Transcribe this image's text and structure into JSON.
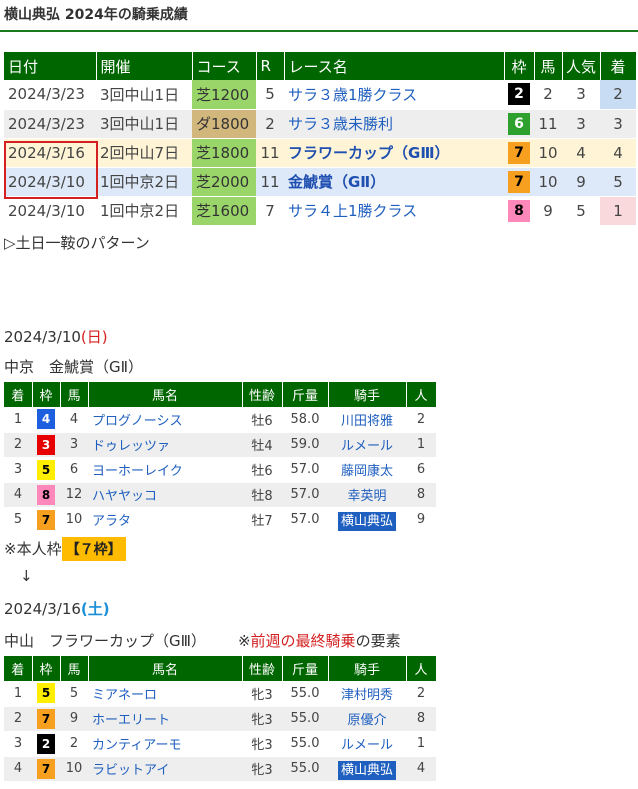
{
  "title": "横山典弘 2024年の騎乗成績",
  "results": {
    "headers": [
      "日付",
      "開催",
      "コース",
      "R",
      "レース名",
      "枠",
      "馬",
      "人気",
      "着"
    ],
    "rows": [
      {
        "date": "2024/3/23",
        "meet": "3回中山1日",
        "course": "芝1200",
        "r": "5",
        "race": "サラ３歳1勝クラス",
        "waku": "2",
        "uma": "2",
        "pop": "3",
        "rank": "2"
      },
      {
        "date": "2024/3/23",
        "meet": "3回中山1日",
        "course": "ダ1800",
        "r": "2",
        "race": "サラ３歳未勝利",
        "waku": "6",
        "uma": "11",
        "pop": "3",
        "rank": "3"
      },
      {
        "date": "2024/3/16",
        "meet": "2回中山7日",
        "course": "芝1800",
        "r": "11",
        "race": "フラワーカップ（GⅢ）",
        "waku": "7",
        "uma": "10",
        "pop": "4",
        "rank": "4"
      },
      {
        "date": "2024/3/10",
        "meet": "1回中京2日",
        "course": "芝2000",
        "r": "11",
        "race": "金鯱賞（GⅡ）",
        "waku": "7",
        "uma": "10",
        "pop": "9",
        "rank": "5"
      },
      {
        "date": "2024/3/10",
        "meet": "1回中京2日",
        "course": "芝1600",
        "r": "7",
        "race": "サラ４上1勝クラス",
        "waku": "8",
        "uma": "9",
        "pop": "5",
        "rank": "1"
      }
    ]
  },
  "pattern_note": "▷土日一鞍のパターン",
  "race1": {
    "date": "2024/3/10",
    "weekday": "(日)",
    "venue_title": "中京　金鯱賞（GⅡ）",
    "headers": [
      "着",
      "枠",
      "馬",
      "馬名",
      "性齢",
      "斤量",
      "騎手",
      "人"
    ],
    "rows": [
      {
        "rank": "1",
        "waku": "4",
        "uma": "4",
        "name": "プログノーシス",
        "sex": "牡6",
        "kin": "58.0",
        "jockey": "川田将雅",
        "pop": "2"
      },
      {
        "rank": "2",
        "waku": "3",
        "uma": "3",
        "name": "ドゥレッツァ",
        "sex": "牡4",
        "kin": "59.0",
        "jockey": "ルメール",
        "pop": "1"
      },
      {
        "rank": "3",
        "waku": "5",
        "uma": "6",
        "name": "ヨーホーレイク",
        "sex": "牡6",
        "kin": "57.0",
        "jockey": "藤岡康太",
        "pop": "6"
      },
      {
        "rank": "4",
        "waku": "8",
        "uma": "12",
        "name": "ハヤヤッコ",
        "sex": "牡8",
        "kin": "57.0",
        "jockey": "幸英明",
        "pop": "8"
      },
      {
        "rank": "5",
        "waku": "7",
        "uma": "10",
        "name": "アラタ",
        "sex": "牡7",
        "kin": "57.0",
        "jockey": "横山典弘",
        "pop": "9"
      }
    ]
  },
  "note_waku_prefix": "※本人枠",
  "note_waku_badge": "【７枠】",
  "arrow": "↓",
  "race2": {
    "date": "2024/3/16",
    "weekday": "(土)",
    "venue_title": "中山　フラワーカップ（GⅢ）",
    "note_prefix": "※",
    "note_red": "前週の最終騎乗",
    "note_suffix": "の要素",
    "headers": [
      "着",
      "枠",
      "馬",
      "馬名",
      "性齢",
      "斤量",
      "騎手",
      "人"
    ],
    "rows": [
      {
        "rank": "1",
        "waku": "5",
        "uma": "5",
        "name": "ミアネーロ",
        "sex": "牝3",
        "kin": "55.0",
        "jockey": "津村明秀",
        "pop": "2"
      },
      {
        "rank": "2",
        "waku": "7",
        "uma": "9",
        "name": "ホーエリート",
        "sex": "牝3",
        "kin": "55.0",
        "jockey": "原優介",
        "pop": "8"
      },
      {
        "rank": "3",
        "waku": "2",
        "uma": "2",
        "name": "カンティアーモ",
        "sex": "牝3",
        "kin": "55.0",
        "jockey": "ルメール",
        "pop": "1"
      },
      {
        "rank": "4",
        "waku": "7",
        "uma": "10",
        "name": "ラビットアイ",
        "sex": "牝3",
        "kin": "55.0",
        "jockey": "横山典弘",
        "pop": "4"
      }
    ]
  }
}
